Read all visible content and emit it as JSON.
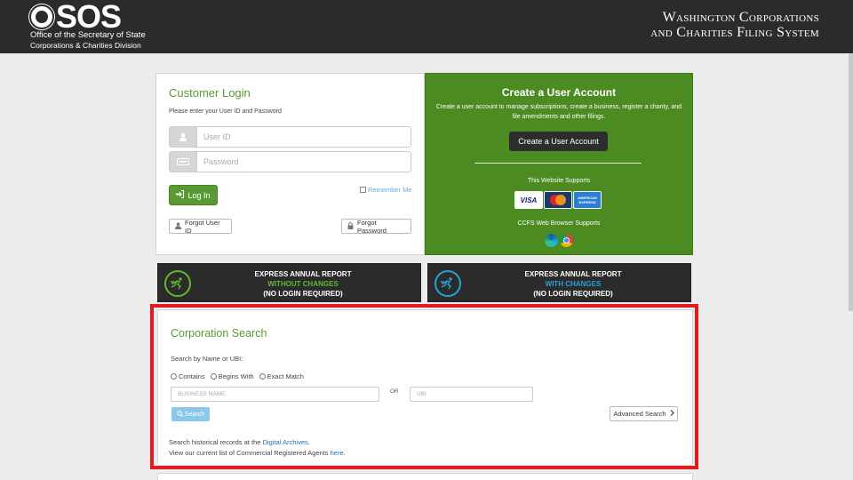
{
  "header": {
    "logo_letters": "SOS",
    "office_name": "Office of the Secretary of State",
    "division_name": "Corporations & Charities Division",
    "system_title_line1": "Washington Corporations",
    "system_title_line2": "and Charities Filing System"
  },
  "login": {
    "title": "Customer Login",
    "subtitle": "Please enter your User ID and Password",
    "user_id_placeholder": "User ID",
    "password_placeholder": "Password",
    "login_button": "Log In",
    "remember_me": "Remember Me",
    "forgot_user_id": "Forgot User ID",
    "forgot_password": "Forgot Password"
  },
  "create_account": {
    "title": "Create a User Account",
    "description": "Create a user account to manage subscriptions, create a business, register a charity, and file amendments and other filings.",
    "button": "Create a User Account",
    "website_supports": "This Website Supports",
    "cards": [
      "VISA",
      "MasterCard",
      "AMERICAN EXPRESS"
    ],
    "browser_supports": "CCFS Web Browser Supports",
    "browsers": [
      "edge-icon",
      "chrome-icon"
    ]
  },
  "express": [
    {
      "line1": "EXPRESS ANNUAL REPORT",
      "line2": "WITHOUT CHANGES",
      "line3": "(NO LOGIN REQUIRED)",
      "accent": "#5fb832"
    },
    {
      "line1": "EXPRESS ANNUAL REPORT",
      "line2": "WITH CHANGES",
      "line3": "(NO LOGIN REQUIRED)",
      "accent": "#2a9fd8"
    }
  ],
  "search": {
    "title": "Corporation Search",
    "subtitle": "Search by Name or UBI:",
    "options": [
      "Contains",
      "Begins With",
      "Exact Match"
    ],
    "name_placeholder": "BUSINESS NAME",
    "or_label": "OR",
    "ubi_placeholder": "UBI",
    "search_button": "Search",
    "advanced_button": "Advanced Search",
    "footer1_prefix": "Search historical records at the ",
    "footer1_link": "Digital Archives",
    "footer1_suffix": ".",
    "footer2_prefix": "View our current list of Commercial Registered Agents ",
    "footer2_link": "here",
    "footer2_suffix": "."
  },
  "colors": {
    "header_bg": "#2b2b2b",
    "brand_green": "#5b9a2f",
    "panel_green": "#4b8b22",
    "link_blue": "#1f6fb5",
    "highlight_red": "#e21b23"
  }
}
